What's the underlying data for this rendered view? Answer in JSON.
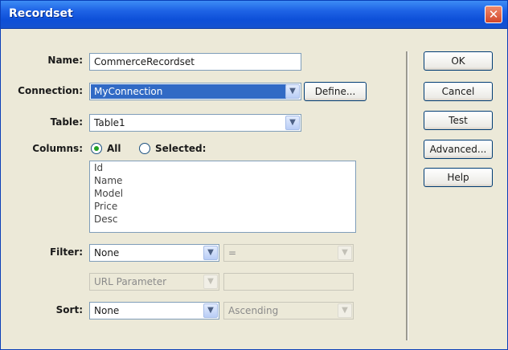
{
  "window": {
    "title": "Recordset",
    "close_glyph": "✕"
  },
  "form": {
    "name_label": "Name:",
    "name_value": "CommerceRecordset",
    "connection_label": "Connection:",
    "connection_value": "MyConnection",
    "define_label": "Define...",
    "table_label": "Table:",
    "table_value": "Table1",
    "columns_label": "Columns:",
    "columns_all": "All",
    "columns_selected": "Selected:",
    "columns_selected_option": "All",
    "columns_list": [
      "Id",
      "Name",
      "Model",
      "Price",
      "Desc"
    ],
    "filter_label": "Filter:",
    "filter_value": "None",
    "filter_operator": "=",
    "filter_source": "URL Parameter",
    "filter_value_input": "",
    "sort_label": "Sort:",
    "sort_value": "None",
    "sort_order": "Ascending"
  },
  "buttons": {
    "ok": "OK",
    "cancel": "Cancel",
    "test": "Test",
    "advanced": "Advanced...",
    "help": "Help"
  },
  "icons": {
    "dropdown": "chevron-down-icon",
    "close": "close-icon"
  }
}
